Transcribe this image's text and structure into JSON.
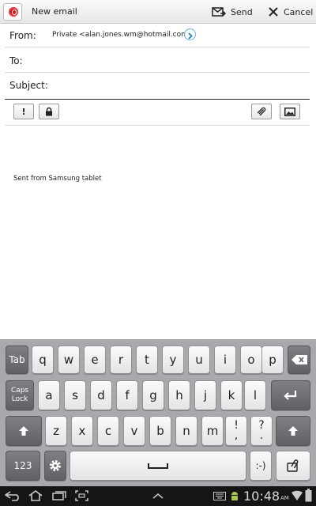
{
  "header": {
    "title": "New email",
    "send_label": "Send",
    "cancel_label": "Cancel"
  },
  "fields": {
    "from_label": "From:",
    "from_value": "Private <alan.jones.wm@hotmail.com>",
    "to_label": "To:",
    "to_value": "",
    "subject_label": "Subject:",
    "subject_value": ""
  },
  "format_bar": {
    "priority_label": "!"
  },
  "body": {
    "signature": "Sent from Samsung tablet"
  },
  "keyboard": {
    "row1": [
      "Tab",
      "q",
      "w",
      "e",
      "r",
      "t",
      "y",
      "u",
      "i",
      "o",
      "p"
    ],
    "row2_letters": [
      "a",
      "s",
      "d",
      "f",
      "g",
      "h",
      "j",
      "k",
      "l"
    ],
    "caps_top": "Caps",
    "caps_bottom": "Lock",
    "row3_letters": [
      "z",
      "x",
      "c",
      "v",
      "b",
      "n",
      "m"
    ],
    "punct1_top": "!",
    "punct1_bottom": ",",
    "punct2_top": "?",
    "punct2_bottom": ".",
    "numbers_label": "123",
    "smiley_label": ":-)"
  },
  "status": {
    "time": "10:48",
    "ampm": "AM"
  },
  "colors": {
    "accent_red": "#c4151a",
    "keyboard_bg": "#a7a9ac",
    "navbar_bg": "#151515"
  }
}
